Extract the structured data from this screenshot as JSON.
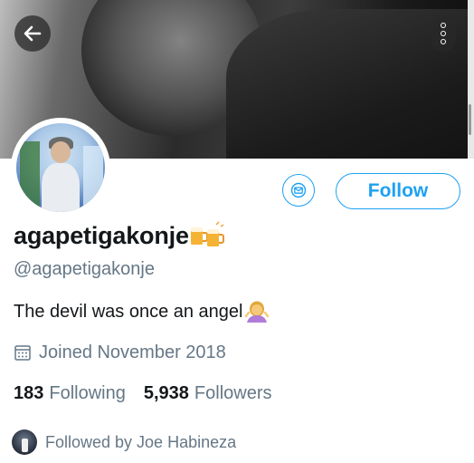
{
  "profile": {
    "display_name": "agapetigakonje",
    "name_emoji": "beer-mugs-emoji",
    "handle": "@agapetigakonje",
    "bio_text": "The devil was once an angel",
    "bio_emoji": "woman-shrugging-emoji",
    "joined": "Joined November 2018",
    "following_count": "183",
    "following_label": "Following",
    "followers_count": "5,938",
    "followers_label": "Followers",
    "followed_by": "Followed by Joe Habineza"
  },
  "actions": {
    "follow_label": "Follow",
    "message_icon": "envelope-icon",
    "back_icon": "back-arrow-icon",
    "more_icon": "more-vertical-icon"
  },
  "colors": {
    "accent": "#1da1f2",
    "secondary_text": "#657786",
    "primary_text": "#14171a"
  }
}
